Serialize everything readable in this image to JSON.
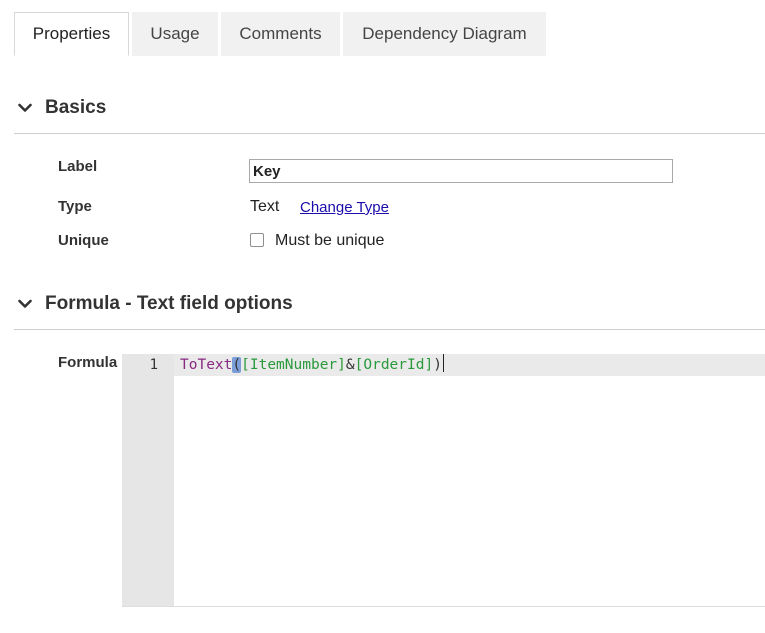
{
  "tabs": [
    {
      "label": "Properties",
      "active": true
    },
    {
      "label": "Usage",
      "active": false
    },
    {
      "label": "Comments",
      "active": false
    },
    {
      "label": "Dependency Diagram",
      "active": false
    }
  ],
  "sections": {
    "basics": {
      "title": "Basics",
      "icon": "chevron-down-icon",
      "fields": {
        "label": {
          "label": "Label",
          "value": "Key"
        },
        "type": {
          "label": "Type",
          "value": "Text",
          "link": "Change Type"
        },
        "unique": {
          "label": "Unique",
          "checkbox_label": "Must be unique",
          "checked": false
        }
      }
    },
    "formula": {
      "title": "Formula - Text field options",
      "icon": "chevron-down-icon",
      "field_label": "Formula",
      "editor": {
        "line_number": "1",
        "tokens": {
          "func": "ToText",
          "open_paren": "(",
          "ref1": "[ItemNumber]",
          "op": "&",
          "ref2": "[OrderId]",
          "close_paren": ")"
        }
      }
    }
  },
  "colors": {
    "link": "#1a0dab",
    "function": "#8a2a83",
    "reference": "#2a9a3c",
    "bracket_highlight": "#7b9ed9",
    "gutter": "#e6e6e6",
    "tab_inactive": "#f1f1f1"
  }
}
